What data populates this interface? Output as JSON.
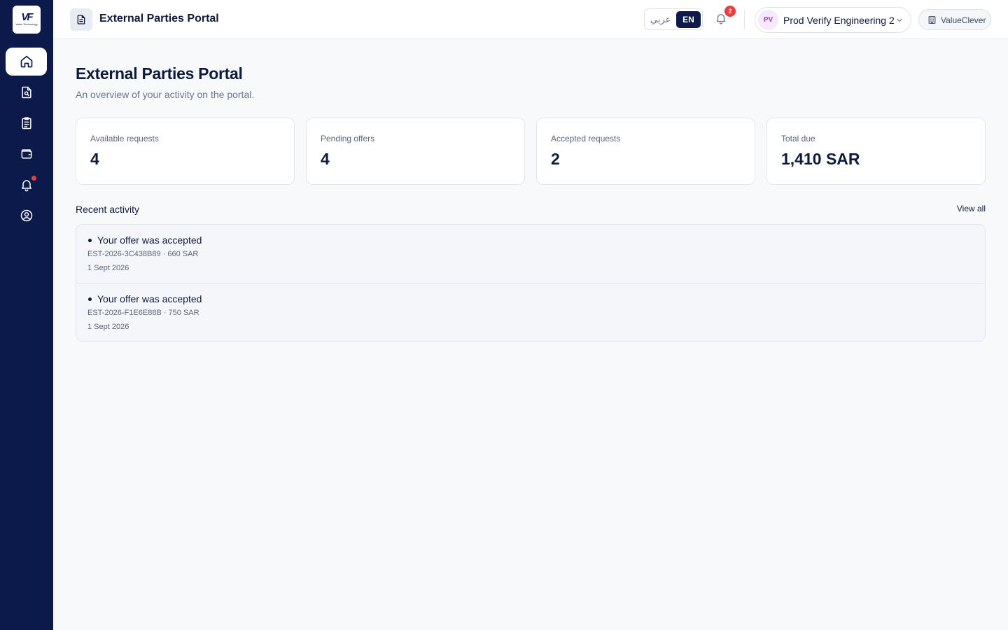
{
  "logo": {
    "mark": "VF",
    "text": "Value Technology"
  },
  "sidebar": {
    "items": [
      {
        "name": "home",
        "icon": "home-icon",
        "active": true
      },
      {
        "name": "document-search",
        "icon": "document-search-icon",
        "active": false
      },
      {
        "name": "clipboard",
        "icon": "clipboard-icon",
        "active": false
      },
      {
        "name": "wallet",
        "icon": "wallet-icon",
        "active": false
      },
      {
        "name": "notifications",
        "icon": "bell-icon",
        "active": false,
        "has_dot": true
      },
      {
        "name": "profile",
        "icon": "user-circle-icon",
        "active": false
      }
    ]
  },
  "header": {
    "title": "External Parties Portal",
    "lang_ar": "عربي",
    "lang_en": "EN",
    "notification_count": "2",
    "user_initials": "PV",
    "user_name": "Prod Verify Engineering 2",
    "org_name": "ValueClever"
  },
  "page": {
    "title": "External Parties Portal",
    "subtitle": "An overview of your activity on the portal."
  },
  "stats": [
    {
      "label": "Available requests",
      "value": "4"
    },
    {
      "label": "Pending offers",
      "value": "4"
    },
    {
      "label": "Accepted requests",
      "value": "2"
    },
    {
      "label": "Total due",
      "value": "1,410 SAR"
    }
  ],
  "recent": {
    "title": "Recent activity",
    "view_all": "View all",
    "items": [
      {
        "title": "Your offer was accepted",
        "ref": "EST-2026-3C438B89 · 660 SAR",
        "date": "1 Sept 2026"
      },
      {
        "title": "Your offer was accepted",
        "ref": "EST-2026-F1E6E88B · 750 SAR",
        "date": "1 Sept 2026"
      }
    ]
  },
  "colors": {
    "sidebar_bg": "#0c1a4b",
    "accent": "#0c1a4b",
    "badge": "#ef3b3b",
    "avatar_text": "#a53ad8"
  }
}
